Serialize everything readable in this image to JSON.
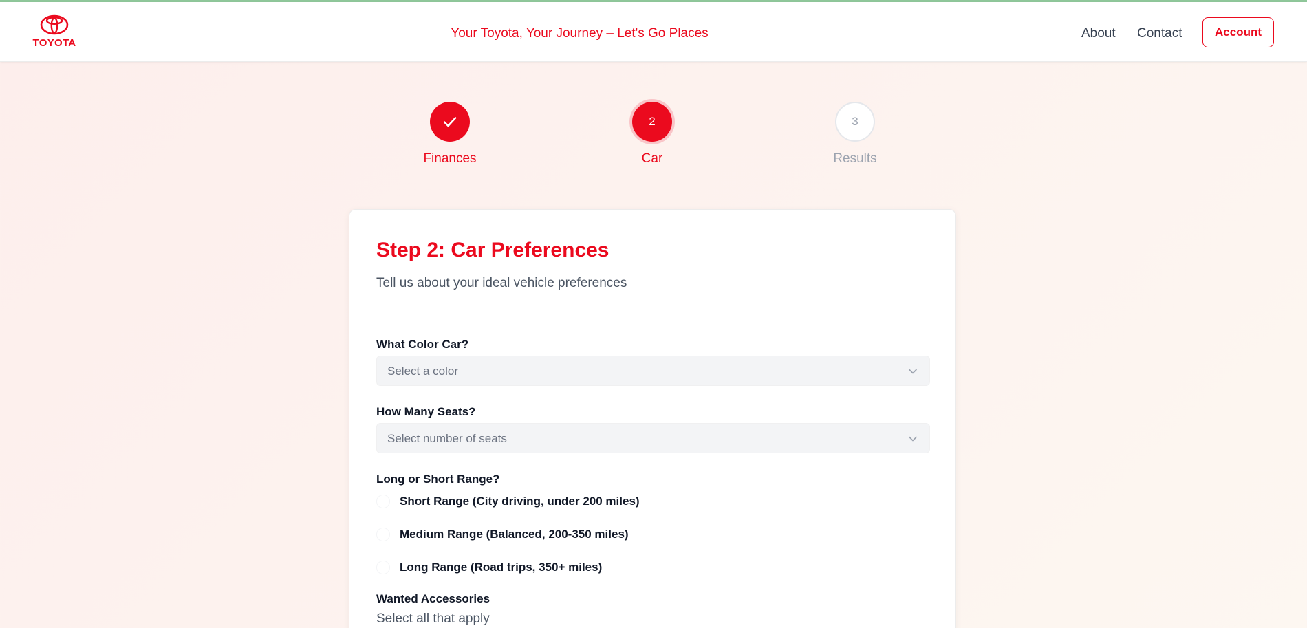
{
  "header": {
    "logo_text": "TOYOTA",
    "tagline": "Your Toyota, Your Journey – Let's Go Places",
    "nav": {
      "about": "About",
      "contact": "Contact"
    },
    "account_label": "Account"
  },
  "stepper": {
    "steps": [
      {
        "label": "Finances",
        "state": "complete"
      },
      {
        "number": "2",
        "label": "Car",
        "state": "active"
      },
      {
        "number": "3",
        "label": "Results",
        "state": "pending"
      }
    ]
  },
  "form": {
    "title": "Step 2: Car Preferences",
    "subtitle": "Tell us about your ideal vehicle preferences",
    "color": {
      "label": "What Color Car?",
      "placeholder": "Select a color"
    },
    "seats": {
      "label": "How Many Seats?",
      "placeholder": "Select number of seats"
    },
    "range": {
      "label": "Long or Short Range?",
      "options": [
        "Short Range (City driving, under 200 miles)",
        "Medium Range (Balanced, 200-350 miles)",
        "Long Range (Road trips, 350+ miles)"
      ]
    },
    "accessories": {
      "label": "Wanted Accessories",
      "hint": "Select all that apply"
    }
  },
  "colors": {
    "brand_red": "#eb0a1e",
    "text_grey": "#4b5563",
    "pending_grey": "#9ca3af"
  }
}
